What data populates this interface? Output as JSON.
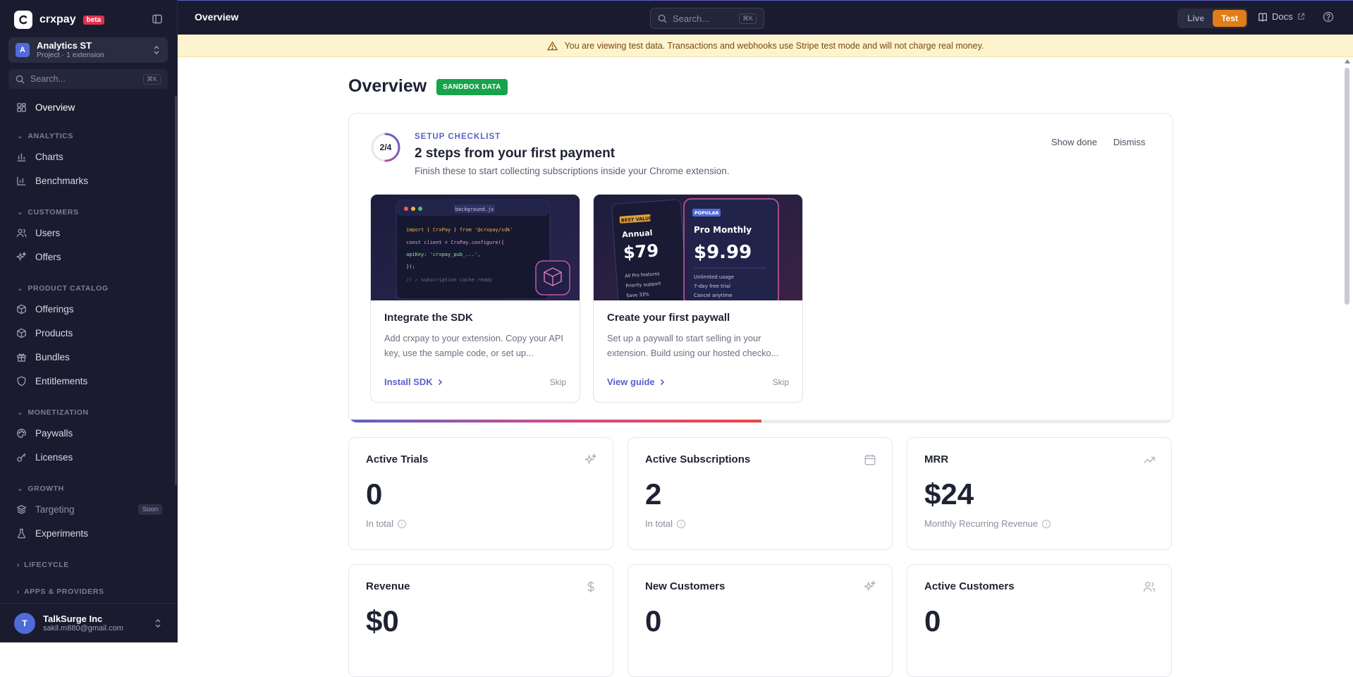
{
  "brand": {
    "name": "crxpay",
    "badge": "beta"
  },
  "project": {
    "initial": "A",
    "name": "Analytics ST",
    "subtitle": "Project · 1 extension"
  },
  "sidebar_search": {
    "placeholder": "Search...",
    "shortcut": "⌘K"
  },
  "sidebar": {
    "overview": "Overview",
    "sections": {
      "analytics": "ANALYTICS",
      "customers": "CUSTOMERS",
      "product_catalog": "PRODUCT CATALOG",
      "monetization": "MONETIZATION",
      "growth": "GROWTH",
      "lifecycle": "LIFECYCLE",
      "apps": "APPS & PROVIDERS"
    },
    "items": {
      "charts": "Charts",
      "benchmarks": "Benchmarks",
      "users": "Users",
      "offers": "Offers",
      "offerings": "Offerings",
      "products": "Products",
      "bundles": "Bundles",
      "entitlements": "Entitlements",
      "paywalls": "Paywalls",
      "licenses": "Licenses",
      "targeting": "Targeting",
      "targeting_badge": "Soon",
      "experiments": "Experiments"
    }
  },
  "user": {
    "initial": "T",
    "name": "TalkSurge Inc",
    "email": "sakil.m880@gmail.com"
  },
  "topbar": {
    "title": "Overview",
    "search_placeholder": "Search...",
    "search_shortcut": "⌘K",
    "mode_live": "Live",
    "mode_test": "Test",
    "active_mode": "test",
    "docs": "Docs"
  },
  "banner": {
    "text": "You are viewing test data. Transactions and webhooks use Stripe test mode and will not charge real money."
  },
  "page": {
    "title": "Overview",
    "badge": "SANDBOX DATA"
  },
  "checklist": {
    "progress_label": "2/4",
    "progress_done": 2,
    "progress_total": 4,
    "eyebrow": "SETUP CHECKLIST",
    "title": "2 steps from your first payment",
    "subtitle": "Finish these to start collecting subscriptions inside your Chrome extension.",
    "show_done": "Show done",
    "dismiss": "Dismiss",
    "progress_fraction": 0.5,
    "steps": [
      {
        "title": "Integrate the SDK",
        "description": "Add crxpay to your extension. Copy your API key, use the sample code, or set up...",
        "cta": "Install SDK",
        "skip": "Skip",
        "art": {
          "filename": "background.js",
          "code": [
            "import { CrxPay } from '@crxpay/sdk'",
            "const client = CrxPay.configure({",
            "  apiKey: 'crxpay_pub_...',",
            "});",
            "// ✓ subscription cache ready"
          ]
        }
      },
      {
        "title": "Create your first paywall",
        "description": "Set up a paywall to start selling in your extension. Build using our hosted checko...",
        "cta": "View guide",
        "skip": "Skip",
        "art": {
          "card1": {
            "badge": "BEST VALUE",
            "plan": "Annual",
            "price": "$79",
            "features": [
              "All Pro features",
              "Priority support",
              "Save 33%"
            ]
          },
          "card2": {
            "badge": "POPULAR",
            "plan": "Pro Monthly",
            "price": "$9.99",
            "features": [
              "Unlimited usage",
              "7-day free trial",
              "Cancel anytime"
            ]
          }
        }
      }
    ]
  },
  "stats": [
    {
      "title": "Active Trials",
      "value": "0",
      "note": "In total",
      "icon": "sparkles-icon"
    },
    {
      "title": "Active Subscriptions",
      "value": "2",
      "note": "In total",
      "icon": "calendar-icon"
    },
    {
      "title": "MRR",
      "value": "$24",
      "note": "Monthly Recurring Revenue",
      "icon": "trending-up-icon"
    },
    {
      "title": "Revenue",
      "value": "$0",
      "note": "",
      "icon": "dollar-icon"
    },
    {
      "title": "New Customers",
      "value": "0",
      "note": "",
      "icon": "sparkles-icon"
    },
    {
      "title": "Active Customers",
      "value": "0",
      "note": "",
      "icon": "users-icon"
    }
  ],
  "colors": {
    "accent": "#5b61c9",
    "test_mode": "#e37d19",
    "sandbox": "#17a34a",
    "sidebar": "#1a1b2e",
    "banner": "#fdf4cf"
  }
}
